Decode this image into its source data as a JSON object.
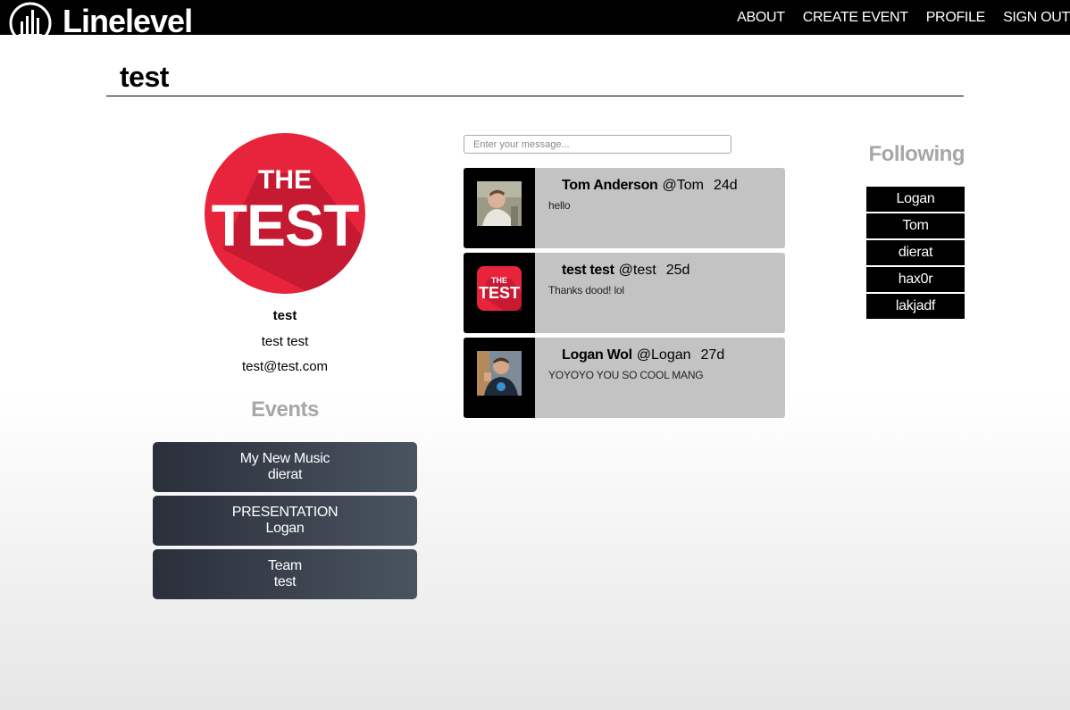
{
  "header": {
    "logo_text": "Linelevel",
    "nav": [
      "ABOUT",
      "CREATE EVENT",
      "PROFILE",
      "SIGN OUT"
    ]
  },
  "page": {
    "title": "test"
  },
  "profile": {
    "avatar_text_top": "THE",
    "avatar_text_bottom": "TEST",
    "username": "test",
    "full_name": "test test",
    "email": "test@test.com"
  },
  "events": {
    "heading": "Events",
    "items": [
      {
        "name": "My New Music",
        "owner": "dierat"
      },
      {
        "name": "PRESENTATION",
        "owner": "Logan"
      },
      {
        "name": "Team",
        "owner": "test"
      }
    ]
  },
  "feed": {
    "input_placeholder": "Enter your message...",
    "posts": [
      {
        "author": "Tom Anderson",
        "handle": "@Tom",
        "age": "24d",
        "message": "hello"
      },
      {
        "author": "test test",
        "handle": "@test",
        "age": "25d",
        "message": "Thanks dood! lol"
      },
      {
        "author": "Logan Wol",
        "handle": "@Logan",
        "age": "27d",
        "message": "YOYOYO YOU SO COOL MANG"
      }
    ]
  },
  "following": {
    "heading": "Following",
    "items": [
      "Logan",
      "Tom",
      "dierat",
      "hax0r",
      "lakjadf"
    ]
  },
  "colors": {
    "brand_red": "#e8243c",
    "heading_gray": "#a7a7a7",
    "post_bg": "#c3c3c3",
    "event_gradient": [
      "#2a2f3a",
      "#4a5461"
    ]
  }
}
